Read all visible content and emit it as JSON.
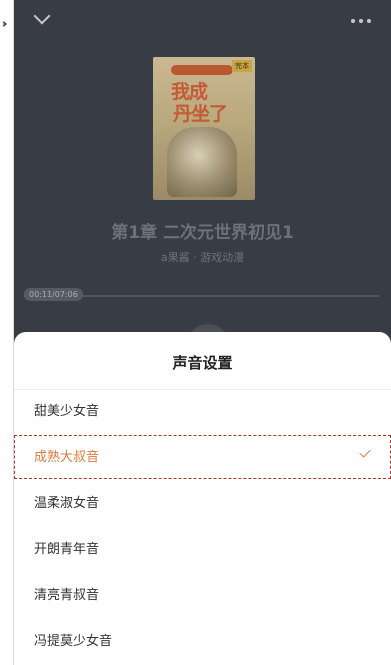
{
  "player": {
    "chapter_title": "第1章 二次元世界初见1",
    "subtitle": "a果酱 · 游戏动漫",
    "time": "00:11/07:06",
    "progress": 0.026,
    "cover": {
      "badge": "完本",
      "title_line1": "我成",
      "title_line2": "丹坐了"
    }
  },
  "sheet": {
    "title": "声音设置",
    "selected_index": 1,
    "items": [
      {
        "label": "甜美少女音"
      },
      {
        "label": "成熟大叔音"
      },
      {
        "label": "温柔淑女音"
      },
      {
        "label": "开朗青年音"
      },
      {
        "label": "清亮青叔音"
      },
      {
        "label": "冯提莫少女音"
      }
    ]
  },
  "colors": {
    "accent": "#e07a3a",
    "overlay": "#383d45"
  }
}
